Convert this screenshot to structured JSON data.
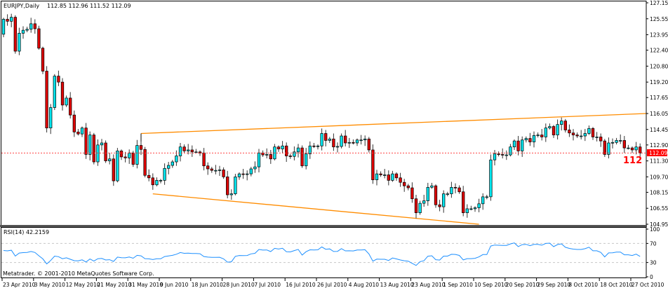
{
  "header": {
    "symbol": "EURJPY,Daily",
    "ohlc": "112.85 112.96 111.52 112.09"
  },
  "bid": {
    "price": "112.09",
    "marker": "112",
    "color": "#ff0000"
  },
  "rsi": {
    "label": "RSI(14) 42.2159",
    "color": "#1e90ff"
  },
  "copyright": "Metatrader. © 2001-2010 MetaQuotes Software Corp.",
  "colors": {
    "bull": "#00e5ee",
    "bear": "#e00000",
    "trendline": "#ff8c00"
  },
  "chart_data": {
    "type": "candlestick",
    "title": "EURJPY,Daily",
    "first_open": 124.0,
    "closes": [
      125.5,
      125.3,
      125.7,
      122.3,
      124.1,
      124.4,
      124.5,
      125.05,
      124.55,
      122.6,
      120.3,
      114.6,
      116.65,
      119.8,
      119.2,
      116.9,
      117.6,
      115.9,
      114.2,
      114.0,
      114.6,
      111.95,
      113.9,
      111.2,
      112.9,
      113.1,
      111.3,
      111.5,
      109.3,
      112.3,
      111.7,
      111.6,
      112.1,
      110.95,
      112.85,
      112.45,
      109.85,
      109.6,
      108.9,
      109.35,
      109.35,
      110.55,
      110.85,
      111.2,
      111.8,
      112.7,
      112.3,
      112.4,
      112.2,
      112.2,
      112.1,
      110.8,
      110.5,
      110.35,
      110.35,
      110.4,
      109.7,
      107.9,
      108.0,
      109.7,
      110.0,
      109.95,
      110.0,
      110.5,
      110.7,
      112.1,
      111.9,
      111.95,
      111.5,
      112.7,
      112.5,
      112.8,
      111.8,
      111.75,
      112.2,
      112.6,
      110.8,
      112.0,
      112.8,
      112.75,
      112.8,
      114.05,
      113.35,
      113.5,
      112.7,
      112.75,
      113.8,
      113.1,
      113.15,
      113.1,
      113.4,
      113.4,
      113.5,
      112.4,
      109.4,
      110.0,
      109.9,
      109.9,
      109.35,
      110.0,
      109.6,
      109.15,
      108.8,
      108.6,
      107.5,
      106.1,
      107.05,
      107.3,
      108.65,
      108.8,
      106.9,
      106.7,
      108.0,
      108.0,
      108.65,
      108.6,
      108.2,
      106.1,
      106.5,
      106.5,
      106.6,
      107.0,
      107.7,
      107.7,
      111.4,
      112.0,
      111.95,
      111.9,
      111.9,
      112.7,
      113.3,
      112.3,
      113.4,
      113.55,
      113.2,
      113.85,
      113.9,
      113.7,
      114.6,
      114.75,
      113.9,
      114.95,
      115.3,
      114.4,
      114.1,
      113.9,
      113.8,
      113.8,
      114.05,
      114.55,
      113.7,
      113.7,
      113.3,
      111.95,
      113.1,
      113.15,
      113.35,
      113.35,
      112.6,
      112.6,
      112.4,
      112.7,
      112.09
    ],
    "ylim": [
      104.95,
      127.15
    ],
    "y_ticks": [
      "127.15",
      "125.55",
      "123.95",
      "122.40",
      "120.80",
      "119.20",
      "117.65",
      "116.05",
      "114.45",
      "112.90",
      "111.30",
      "109.70",
      "108.15",
      "106.55",
      "104.95"
    ],
    "x_labels": [
      "23 Apr 2010",
      "3 May 2010",
      "12 May 2010",
      "21 May 2010",
      "31 May 2010",
      "9 Jun 2010",
      "18 Jun 2010",
      "28 Jun 2010",
      "7 Jul 2010",
      "16 Jul 2010",
      "26 Jul 2010",
      "4 Aug 2010",
      "13 Aug 2010",
      "23 Aug 2010",
      "1 Sep 2010",
      "10 Sep 2010",
      "20 Sep 2010",
      "29 Sep 2010",
      "8 Oct 2010",
      "18 Oct 2010",
      "27 Oct 2010"
    ],
    "bars_per_label": 8,
    "trendlines": [
      {
        "name": "upper",
        "from_bar": 35,
        "from_price": 114.05,
        "to_bar": 164,
        "to_price": 116.05
      },
      {
        "name": "lower",
        "from_bar": 38,
        "from_price": 108.0,
        "to_bar": 121,
        "to_price": 104.95
      }
    ],
    "rsi_period": 14,
    "rsi_ylim": [
      0,
      100
    ],
    "rsi_ticks": [
      "100",
      "70",
      "30",
      "0"
    ],
    "rsi_levels": [
      70,
      30
    ]
  }
}
